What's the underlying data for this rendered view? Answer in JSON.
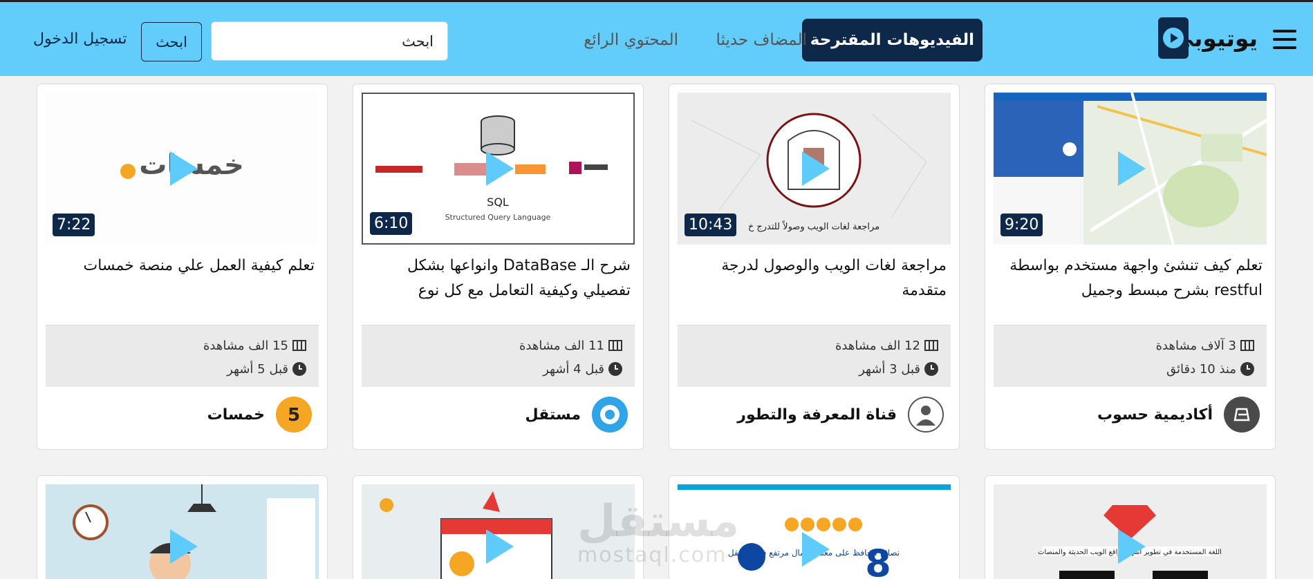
{
  "brand": {
    "name": "يوتيوبي"
  },
  "nav": {
    "tabs": [
      {
        "label": "الفيديوهات المقترحة",
        "active": true
      },
      {
        "label": "المضاف حديثا",
        "active": false
      },
      {
        "label": "المحتوي الرائع",
        "active": false
      }
    ],
    "search_value": "ابحث",
    "search_button": "ابحث",
    "login": "تسجيل الدخول"
  },
  "videos": [
    {
      "title": "تعلم كيف تنشئ واجهة مستخدم بواسطة restful بشرح مبسط وجميل",
      "duration": "9:20",
      "views": "3 آلاف مشاهدة",
      "time": "منذ 10 دقائق",
      "channel": "أكاديمية حسوب"
    },
    {
      "title": "مراجعة لغات الويب والوصول لدرجة متقدمة",
      "duration": "10:43",
      "views": "12 الف مشاهدة",
      "time": "قبل 3 أشهر",
      "channel": "قناة المعرفة والتطور",
      "thumb_caption": "مراجعة لغات الويب وصولاً للتدرج خ"
    },
    {
      "title": "شرح الـ DataBase وانواعها بشكل تفصيلي وكيفية التعامل مع كل نوع",
      "duration": "6:10",
      "views": "11 الف مشاهدة",
      "time": "قبل 4 أشهر",
      "channel": "مستقل",
      "thumb_sql": "SQL",
      "thumb_sql_sub": "Structured Query Language"
    },
    {
      "title": "تعلم كيفية العمل علي منصة خمسات",
      "duration": "7:22",
      "views": "15 الف مشاهدة",
      "time": "قبل 5 أشهر",
      "channel": "خمسات",
      "thumb_logo": "خمسات"
    }
  ],
  "row2_text": {
    "c1_caption": "اللغة المستخدمة في تطوير أشهر مواقع الويب الحديثة والمنصات",
    "c2_caption": "نصائح لتحافظ على معدل اكمال مرتفع في مستقل",
    "c2_number": "8"
  },
  "watermark": {
    "arabic": "مستقل",
    "latin": "mostaql.com"
  },
  "colors": {
    "navbar": "#62ccfb",
    "accent": "#0d2849",
    "play": "#5ecbfa"
  }
}
